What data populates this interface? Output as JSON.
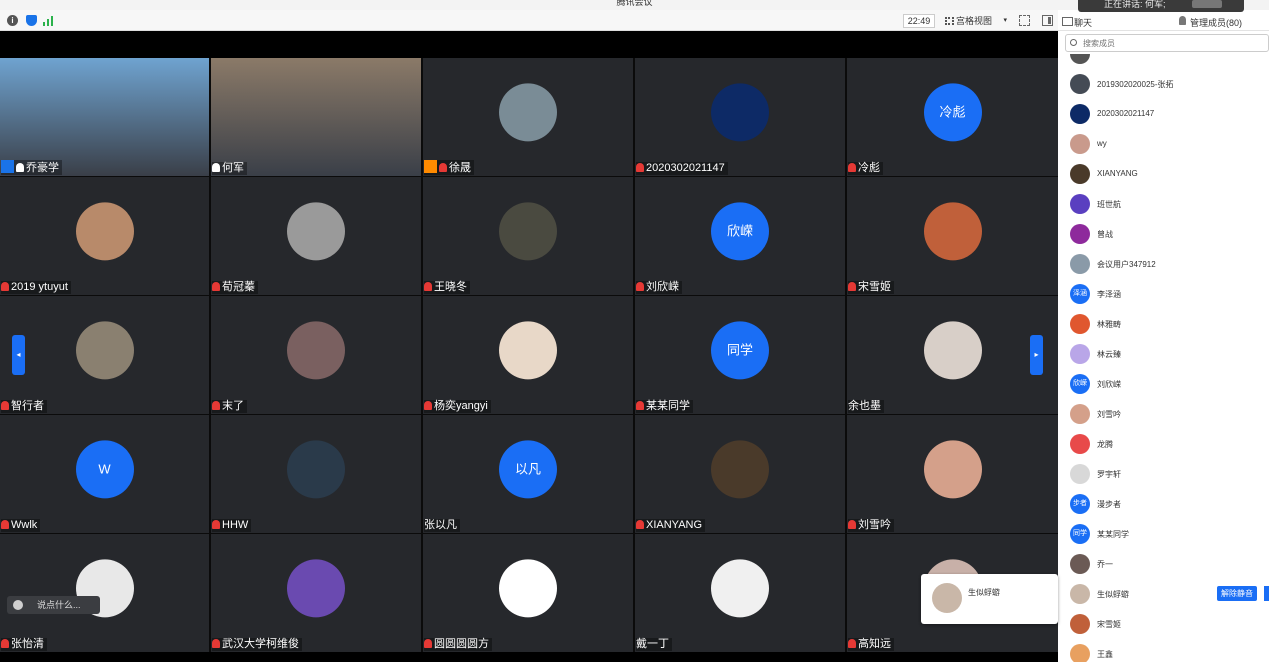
{
  "window": {
    "title": "腾讯会议"
  },
  "speaking_toast": {
    "text": "正在讲话: 何军;"
  },
  "toolbar": {
    "clock": "22:49",
    "view_label": "宫格视图",
    "icons": [
      "info-icon",
      "shield-icon",
      "signal-icon",
      "fullscreen-icon",
      "sidebar-toggle-icon"
    ]
  },
  "sidebar": {
    "chat_tab": "聊天",
    "members_tab": "管理成员(80)",
    "search_placeholder": "搜索成员",
    "members": [
      {
        "name": "",
        "color": "#555555"
      },
      {
        "name": "2019302020025-张拓",
        "color": "#444b55"
      },
      {
        "name": "2020302021147",
        "color": "#0d2a66"
      },
      {
        "name": "wy",
        "color": "#c99a8c"
      },
      {
        "name": "XIANYANG",
        "color": "#4a3a2a"
      },
      {
        "name": "班世航",
        "color": "#5a3fc0"
      },
      {
        "name": "曾战",
        "color": "#8e2a9c"
      },
      {
        "name": "会议用户347912",
        "color": "#8a9aa8"
      },
      {
        "name": "李泽涵",
        "avatar_text": "泽涵",
        "color": "#1a6ef5"
      },
      {
        "name": "林雅畴",
        "color": "#e0572f"
      },
      {
        "name": "林云臻",
        "color": "#b9a6e8"
      },
      {
        "name": "刘欣嵘",
        "avatar_text": "欣嵘",
        "color": "#1a6ef5"
      },
      {
        "name": "刘雪吟",
        "color": "#d4a08a"
      },
      {
        "name": "龙腾",
        "color": "#e84a4a"
      },
      {
        "name": "罗宇轩",
        "color": "#d8d8d8"
      },
      {
        "name": "漫步者",
        "avatar_text": "步者",
        "color": "#1a6ef5"
      },
      {
        "name": "某某同学",
        "avatar_text": "同学",
        "color": "#1a6ef5"
      },
      {
        "name": "乔一",
        "color": "#6b5a55"
      },
      {
        "name": "生似蜉蝣",
        "color": "#c9b7a8",
        "action": "解除静音"
      },
      {
        "name": "宋雪姬",
        "color": "#c0603a"
      },
      {
        "name": "王鑫",
        "color": "#e8a060"
      }
    ]
  },
  "grid": {
    "tiles": [
      {
        "name": "乔豪学",
        "type": "video",
        "badge": "blue",
        "mic": "on",
        "scene": "#6fa3d0"
      },
      {
        "name": "何军",
        "type": "video",
        "mic": "on",
        "active": true,
        "scene": "#8b7a68"
      },
      {
        "name": "徐晟",
        "badge": "orange",
        "mic": "off",
        "avatar_color": "#7a8c96"
      },
      {
        "name": "2020302021147",
        "mic": "off",
        "avatar_color": "#0d2a66"
      },
      {
        "name": "冷彪",
        "mic": "off",
        "avatar_text": "冷彪"
      },
      {
        "name": "2019 ytuyut",
        "mic": "off",
        "avatar_color": "#b88a6a"
      },
      {
        "name": "荀冠蓁",
        "mic": "off",
        "avatar_color": "#9a9a9a"
      },
      {
        "name": "王晓冬",
        "mic": "off",
        "avatar_color": "#4a4a40"
      },
      {
        "name": "刘欣嵘",
        "mic": "off",
        "avatar_text": "欣嵘"
      },
      {
        "name": "宋雪姬",
        "mic": "off",
        "avatar_color": "#c0603a"
      },
      {
        "name": "智行者",
        "mic": "off",
        "avatar_color": "#8a8070"
      },
      {
        "name": "末了",
        "mic": "off",
        "avatar_color": "#7a6060"
      },
      {
        "name": "杨奕yangyi",
        "mic": "off",
        "avatar_color": "#e8d8c8"
      },
      {
        "name": "某某同学",
        "mic": "off",
        "avatar_text": "同学"
      },
      {
        "name": "余也墨",
        "mic": "none",
        "avatar_color": "#d8cfc8"
      },
      {
        "name": "Wwlk",
        "mic": "off",
        "avatar_text": "W"
      },
      {
        "name": "HHW",
        "mic": "off",
        "avatar_color": "#2a3a4a"
      },
      {
        "name": "张以凡",
        "mic": "none",
        "avatar_text": "以凡"
      },
      {
        "name": "XIANYANG",
        "mic": "off",
        "avatar_color": "#4a3a2a"
      },
      {
        "name": "刘雪吟",
        "mic": "off",
        "avatar_color": "#d4a08a"
      },
      {
        "name": "张怡清",
        "mic": "off",
        "avatar_color": "#e8e8e8"
      },
      {
        "name": "武汉大学柯维俊",
        "mic": "off",
        "avatar_color": "#6a4ab0"
      },
      {
        "name": "圆圆圆圆方",
        "mic": "off",
        "avatar_color": "#ffffff"
      },
      {
        "name": "戴一丁",
        "mic": "none",
        "avatar_color": "#f0f0f0"
      },
      {
        "name": "高知远",
        "mic": "off",
        "avatar_color": "#c8b0a8"
      }
    ]
  },
  "chat_input": {
    "placeholder": "说点什么..."
  },
  "popup": {
    "name": "生似蜉蝣"
  }
}
